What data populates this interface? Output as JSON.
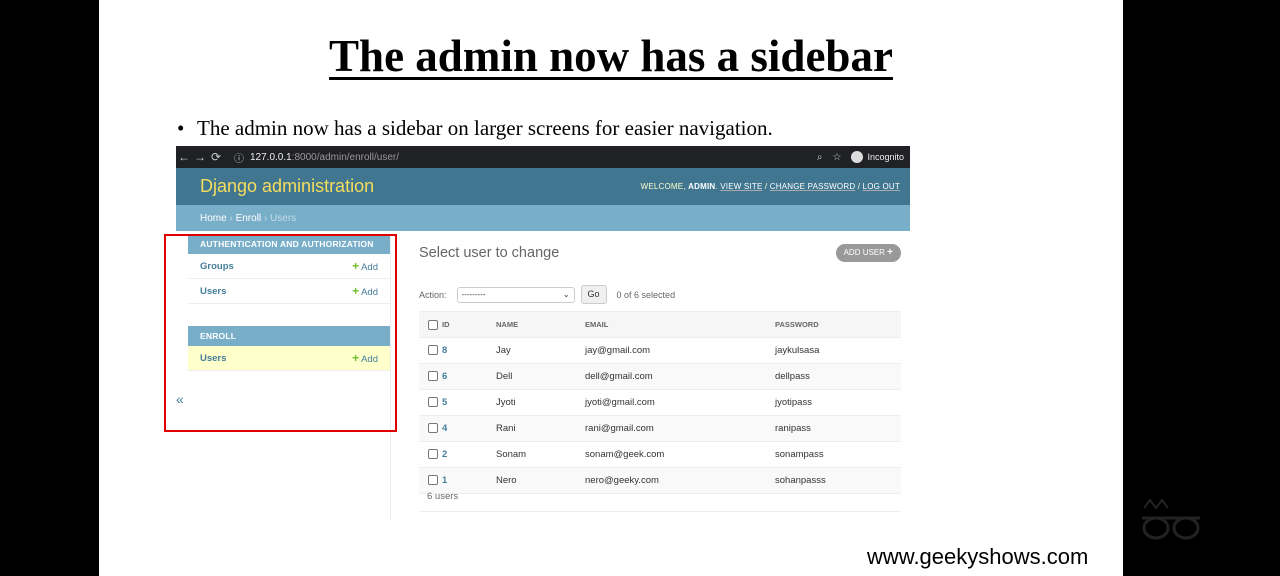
{
  "slide": {
    "title": "The admin now has a sidebar",
    "bullet": "The admin now has a sidebar on larger screens for easier navigation.",
    "footer_url": "www.geekyshows.com"
  },
  "browser": {
    "url_host": "127.0.0.1",
    "url_rest": ":8000/admin/enroll/user/",
    "incognito_label": "Incognito"
  },
  "header": {
    "brand": "Django administration",
    "welcome": "WELCOME,",
    "user": "ADMIN",
    "view_site": "VIEW SITE",
    "change_password": "CHANGE PASSWORD",
    "log_out": "LOG OUT"
  },
  "breadcrumbs": {
    "home": "Home",
    "app": "Enroll",
    "current": "Users"
  },
  "sidebar": {
    "modules": [
      {
        "caption": "AUTHENTICATION AND AUTHORIZATION",
        "rows": [
          {
            "label": "Groups",
            "add": "Add"
          },
          {
            "label": "Users",
            "add": "Add"
          }
        ]
      },
      {
        "caption": "ENROLL",
        "rows": [
          {
            "label": "Users",
            "add": "Add"
          }
        ]
      }
    ],
    "toggle": "«"
  },
  "main": {
    "title": "Select user to change",
    "add_button": "ADD USER",
    "action_label": "Action:",
    "action_select": "---------",
    "go": "Go",
    "counter": "0 of 6 selected",
    "columns": [
      "ID",
      "NAME",
      "EMAIL",
      "PASSWORD"
    ],
    "rows": [
      {
        "id": "8",
        "name": "Jay",
        "email": "jay@gmail.com",
        "password": "jaykulsasa"
      },
      {
        "id": "6",
        "name": "Dell",
        "email": "dell@gmail.com",
        "password": "dellpass"
      },
      {
        "id": "5",
        "name": "Jyoti",
        "email": "jyoti@gmail.com",
        "password": "jyotipass"
      },
      {
        "id": "4",
        "name": "Rani",
        "email": "rani@gmail.com",
        "password": "ranipass"
      },
      {
        "id": "2",
        "name": "Sonam",
        "email": "sonam@geek.com",
        "password": "sonampass"
      },
      {
        "id": "1",
        "name": "Nero",
        "email": "nero@geeky.com",
        "password": "sohanpasss"
      }
    ],
    "paginator": "6 users"
  },
  "colors": {
    "header": "#417690",
    "breadcrumbs": "#79aec8",
    "brand": "#f5dd5d",
    "highlight": "#e00000"
  }
}
